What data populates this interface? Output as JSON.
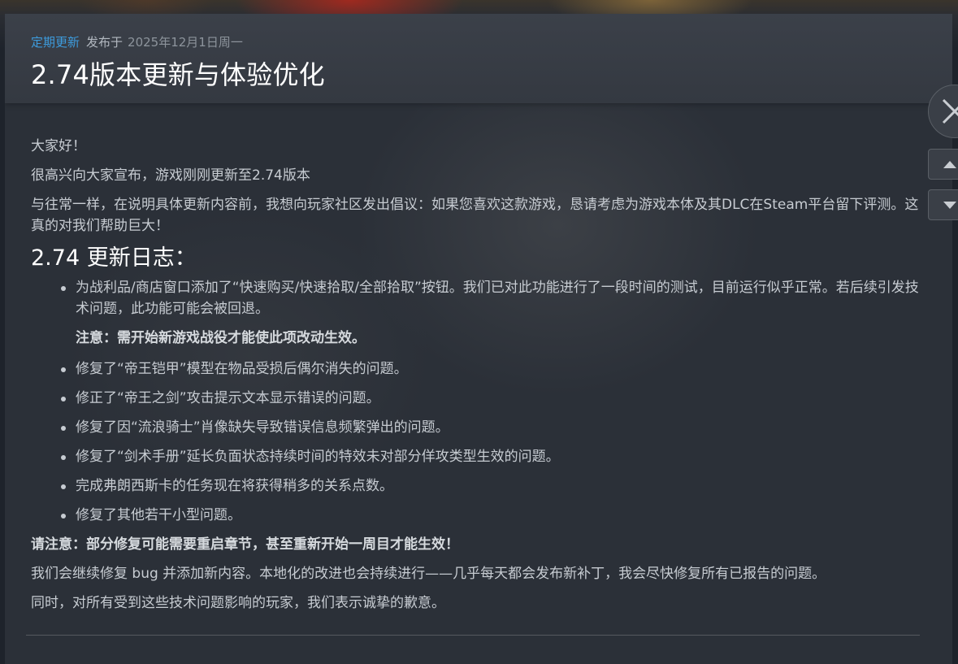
{
  "header": {
    "tag": "定期更新",
    "published_prefix": "发布于",
    "date": "2025年12月1日周一",
    "title": "2.74版本更新与体验优化"
  },
  "body": {
    "greeting": "大家好！",
    "intro": "很高兴向大家宣布，游戏刚刚更新至2.74版本",
    "review_request": "与往常一样，在说明具体更新内容前，我想向玩家社区发出倡议：如果您喜欢这款游戏，恳请考虑为游戏本体及其DLC在Steam平台留下评测。这真的对我们帮助巨大！",
    "changelog_heading": "2.74 更新日志：",
    "first_item": "为战利品/商店窗口添加了“快速购买/快速拾取/全部拾取”按钮。我们已对此功能进行了一段时间的测试，目前运行似乎正常。若后续引发技术问题，此功能可能会被回退。",
    "first_item_note": "注意：需开始新游戏战役才能使此项改动生效。",
    "items": [
      "修复了“帝王铠甲”模型在物品受损后偶尔消失的问题。",
      "修正了“帝王之剑”攻击提示文本显示错误的问题。",
      "修复了因“流浪骑士”肖像缺失导致错误信息频繁弹出的问题。",
      "修复了“剑术手册”延长负面状态持续时间的特效未对部分佯攻类型生效的问题。",
      "完成弗朗西斯卡的任务现在将获得稍多的关系点数。",
      "修复了其他若干小型问题。"
    ],
    "warning": "请注意：部分修复可能需要重启章节，甚至重新开始一周目才能生效！",
    "continue_text": "我们会继续修复 bug 并添加新内容。本地化的改进也会持续进行——几乎每天都会发布新补丁，我会尽快修复所有已报告的问题。",
    "apology": "同时，对所有受到这些技术问题影响的玩家，我们表示诚挚的歉意。"
  },
  "colors": {
    "accent": "#3d9bdc",
    "panel": "#2b3038",
    "header": "#3b4049"
  },
  "icons": {
    "close": "close-icon",
    "prev": "chevron-up-icon",
    "next": "chevron-down-icon"
  }
}
